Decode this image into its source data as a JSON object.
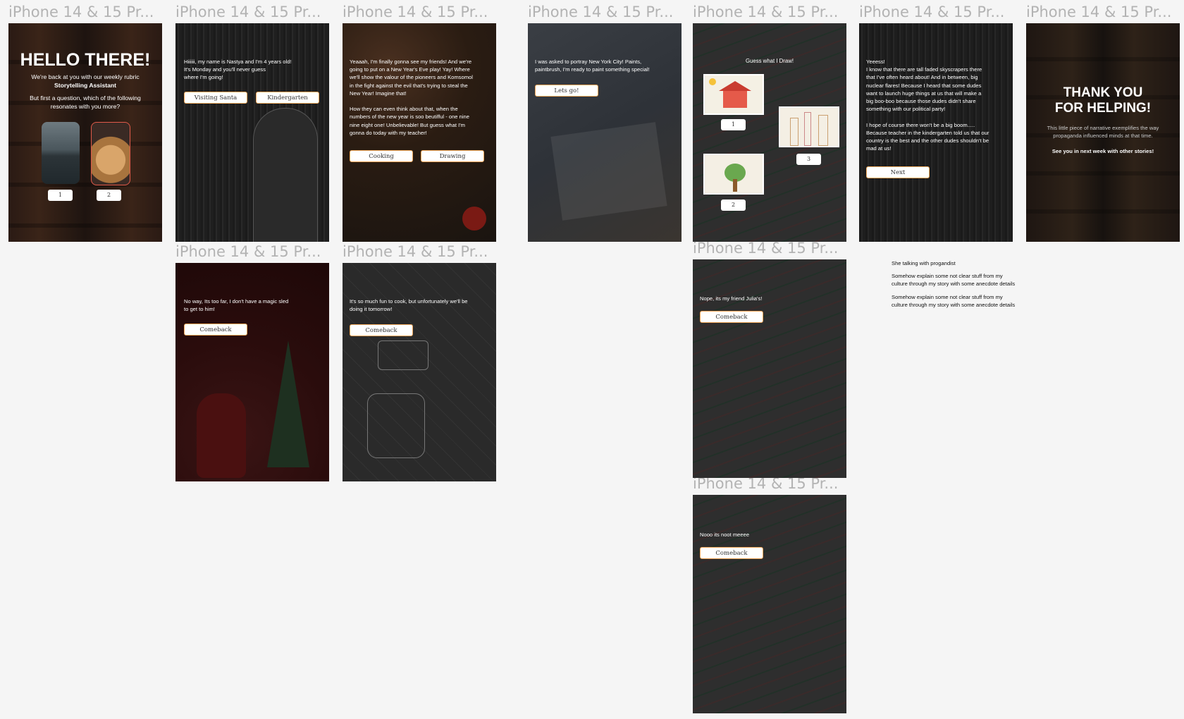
{
  "frame_label": "iPhone 14 & 15 Pr...",
  "intro": {
    "title": "HELLO THERE!",
    "subtitle": "We're back at you with our weekly rubric",
    "subtitle_bold": "Storytelling Assistant",
    "question": "But first a question, which of the following\nresonates with you more?",
    "option1": "1",
    "option2": "2"
  },
  "nastya": {
    "text": "Hiiiiii, my name is Nastya and I'm 4 years old!\nIt's Monday and you'll never guess\nwhere I'm going!",
    "btn1": "Visiting Santa",
    "btn2": "Kindergarten"
  },
  "newyear": {
    "text": "Yeaaah, I'm finally gonna see my friends! And we're\ngoing to put on a New Year's Eve play! Yay! Where\nwe'll show the valour of the pioneers and Komsomol\nin the fight against the evil that's trying to steal the\nNew Year! Imagine that!\n\nHow they can even think about that, when the\nnumbers of the new year is soo beutifful - one nine\nnine eight one! Unbelievable! But guess what I'm\ngonna do today with my teacher!",
    "btn1": "Cooking",
    "btn2": "Drawing"
  },
  "santa": {
    "text": "No way, Its too far, I don't have a magic sled\nto get to him!",
    "btn": "Comeback"
  },
  "cooking": {
    "text": "It's so much fun to cook, but unfortunately we'll be\ndoing it tomorrow!",
    "btn": "Comeback"
  },
  "nyc": {
    "text": "I was asked to portray New York City! Paints,\npaintbrush, I'm ready to paint something special!",
    "btn": "Lets go!"
  },
  "draw": {
    "text": "Guess what I Draw!",
    "opt1": "1",
    "opt2": "2",
    "opt3": "3"
  },
  "julia": {
    "text": "Nope, its my friend Julia's!",
    "btn": "Comeback"
  },
  "meee": {
    "text": "Nooo its noot meeee",
    "btn": "Comeback"
  },
  "skyscrapers": {
    "text": "Yeeess!\nI know that there are tall faded skyscrapers there\nthat I've often heard about!  And in between, big\nnuclear flares! Because I heard that some dudes\nwant to launch huge things at us that will make a\nbig boo-boo because those dudes didn't share\nsomething with our political party!\n\nI hope of course there won't be a big boom.....\nBecause teacher in the kindergarten told us that our\ncountry is the best and the other dudes shouldn't be\nmad at us!",
    "btn": "Next"
  },
  "thanks": {
    "title": "THANK YOU\nFOR HELPING!",
    "sub": "This little piece of narrative exemplifies the way\npropaganda influenced minds at that time.",
    "bold": "See you in next week with other stories!"
  },
  "notes": {
    "n1": "She talking with progandist",
    "n2": "Somehow explain some not clear stuff from my\nculture through my story with some anecdote details",
    "n3": "Somehow explain some not clear stuff from my\nculture through my story with some anecdote details"
  }
}
